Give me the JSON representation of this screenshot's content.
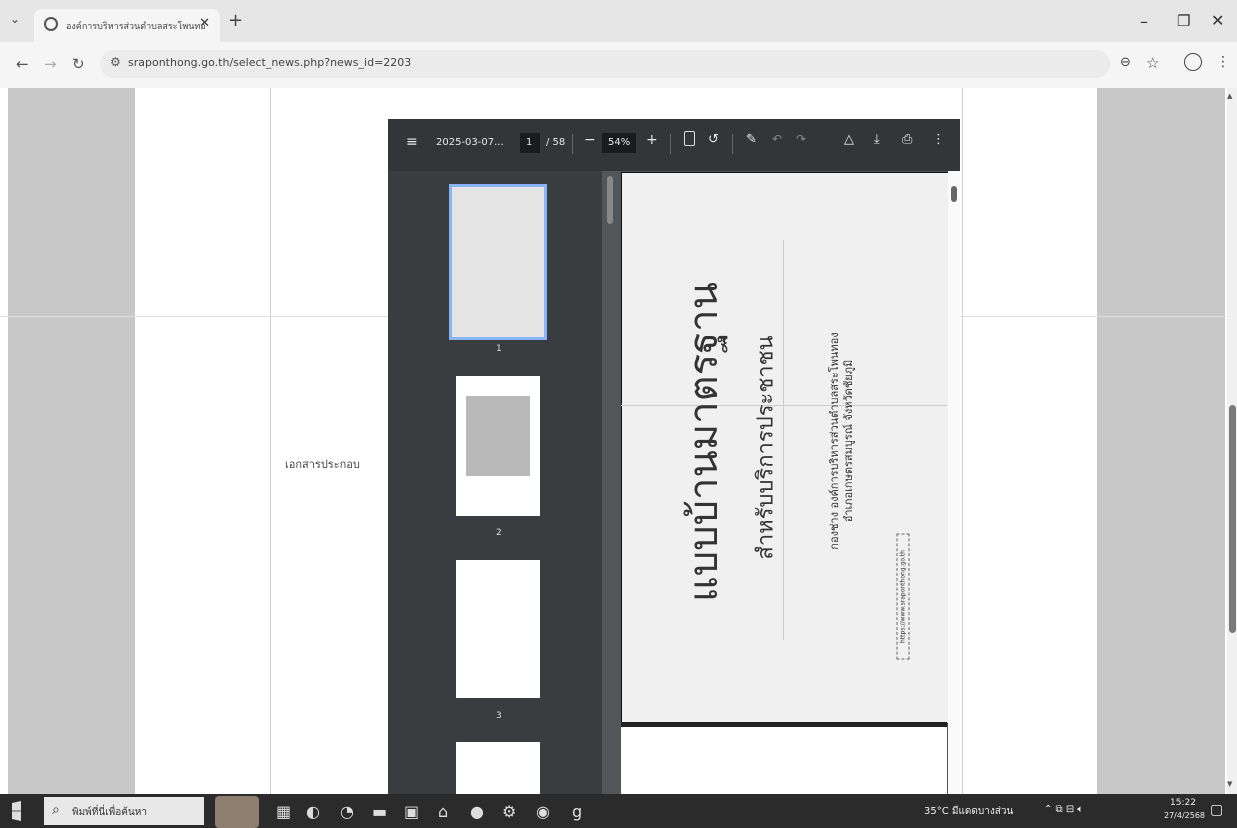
{
  "browser": {
    "tab_title": "องค์การบริหารส่วนตำบลสระโพนทอง",
    "url": "sraponthong.go.th/select_news.php?news_id=2203"
  },
  "page": {
    "doc_label": "เอกสารประกอบ"
  },
  "pdf": {
    "title": "2025-03-07...",
    "page_current": "1",
    "page_total": "/ 58",
    "zoom": "54%",
    "thumb_labels": [
      "1",
      "2",
      "3"
    ],
    "page_text": {
      "line1": "แบบบ้านมาตรฐาน",
      "line2": "สำหรับบริการประชาชน",
      "line3": "กองช่าง องค์การบริหารส่วนตำบลสระโพนทอง",
      "line4": "อำเภอเกษตรสมบูรณ์ จังหวัดชัยภูมิ",
      "url_box": "https://www.sraponthong.go.th"
    }
  },
  "taskbar": {
    "search_placeholder": "พิมพ์ที่นี่เพื่อค้นหา",
    "weather": "35°C มีแดดบางส่วน",
    "time": "15:22",
    "date": "27/4/2568"
  }
}
